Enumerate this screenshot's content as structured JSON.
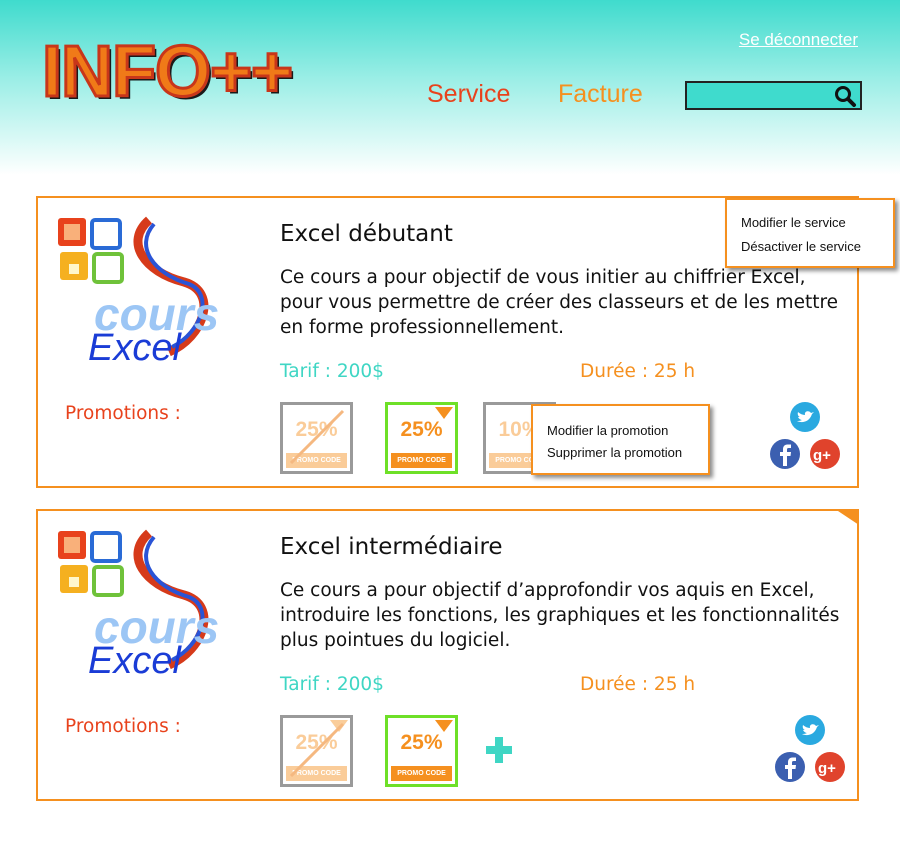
{
  "header": {
    "logo_text": "INFO++",
    "logout_label": "Se déconnecter",
    "nav": {
      "service": "Service",
      "facture": "Facture"
    },
    "search": {
      "value": "",
      "placeholder": ""
    }
  },
  "courses": [
    {
      "logo_words": {
        "cours": "cours",
        "excel": "Excel"
      },
      "title": "Excel débutant",
      "description": "Ce cours a pour objectif de vous initier au chiffrier Excel, pour vous permettre de créer des classeurs et de les mettre en forme professionnellement.",
      "tarif": "Tarif : 200$",
      "duree": "Durée : 25 h",
      "promos_label": "Promotions :",
      "promos": [
        {
          "value": "25%",
          "code": "PROMO CODE"
        },
        {
          "value": "25%",
          "code": "PROMO CODE"
        },
        {
          "value": "10%",
          "code": "PROMO CODE"
        }
      ],
      "service_menu": {
        "modify": "Modifier le service",
        "deactivate": "Désactiver le service"
      },
      "promo_menu": {
        "modify": "Modifier la promotion",
        "delete": "Supprimer la promotion"
      }
    },
    {
      "logo_words": {
        "cours": "cours",
        "excel": "Excel"
      },
      "title": "Excel intermédiaire",
      "description": "Ce cours a pour objectif d’approfondir vos aquis en Excel, introduire les fonctions, les graphiques et les fonctionnalités plus pointues du logiciel.",
      "tarif": "Tarif : 200$",
      "duree": "Durée : 25 h",
      "promos_label": "Promotions :",
      "promos": [
        {
          "value": "25%",
          "code": "PROMO CODE"
        },
        {
          "value": "25%",
          "code": "PROMO CODE"
        }
      ]
    }
  ],
  "colors": {
    "accent_orange": "#f5901f",
    "accent_red": "#e8421c",
    "accent_teal": "#3fd6c4",
    "active_green": "#6ee028"
  },
  "icons": [
    "search-icon",
    "twitter-icon",
    "facebook-icon",
    "google-plus-icon",
    "add-promo-icon"
  ]
}
